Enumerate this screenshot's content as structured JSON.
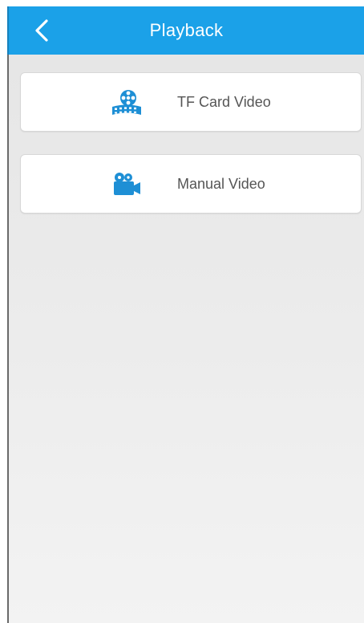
{
  "header": {
    "title": "Playback",
    "back_icon": "chevron-left-icon",
    "color": "#1ba1e8"
  },
  "menu": {
    "items": [
      {
        "label": "TF Card Video",
        "icon": "film-reel-icon"
      },
      {
        "label": "Manual Video",
        "icon": "video-camera-icon"
      }
    ]
  },
  "colors": {
    "accent": "#1ba1e8",
    "icon": "#1e8fd5",
    "item_text": "#555555",
    "background": "#e9e9e9"
  }
}
